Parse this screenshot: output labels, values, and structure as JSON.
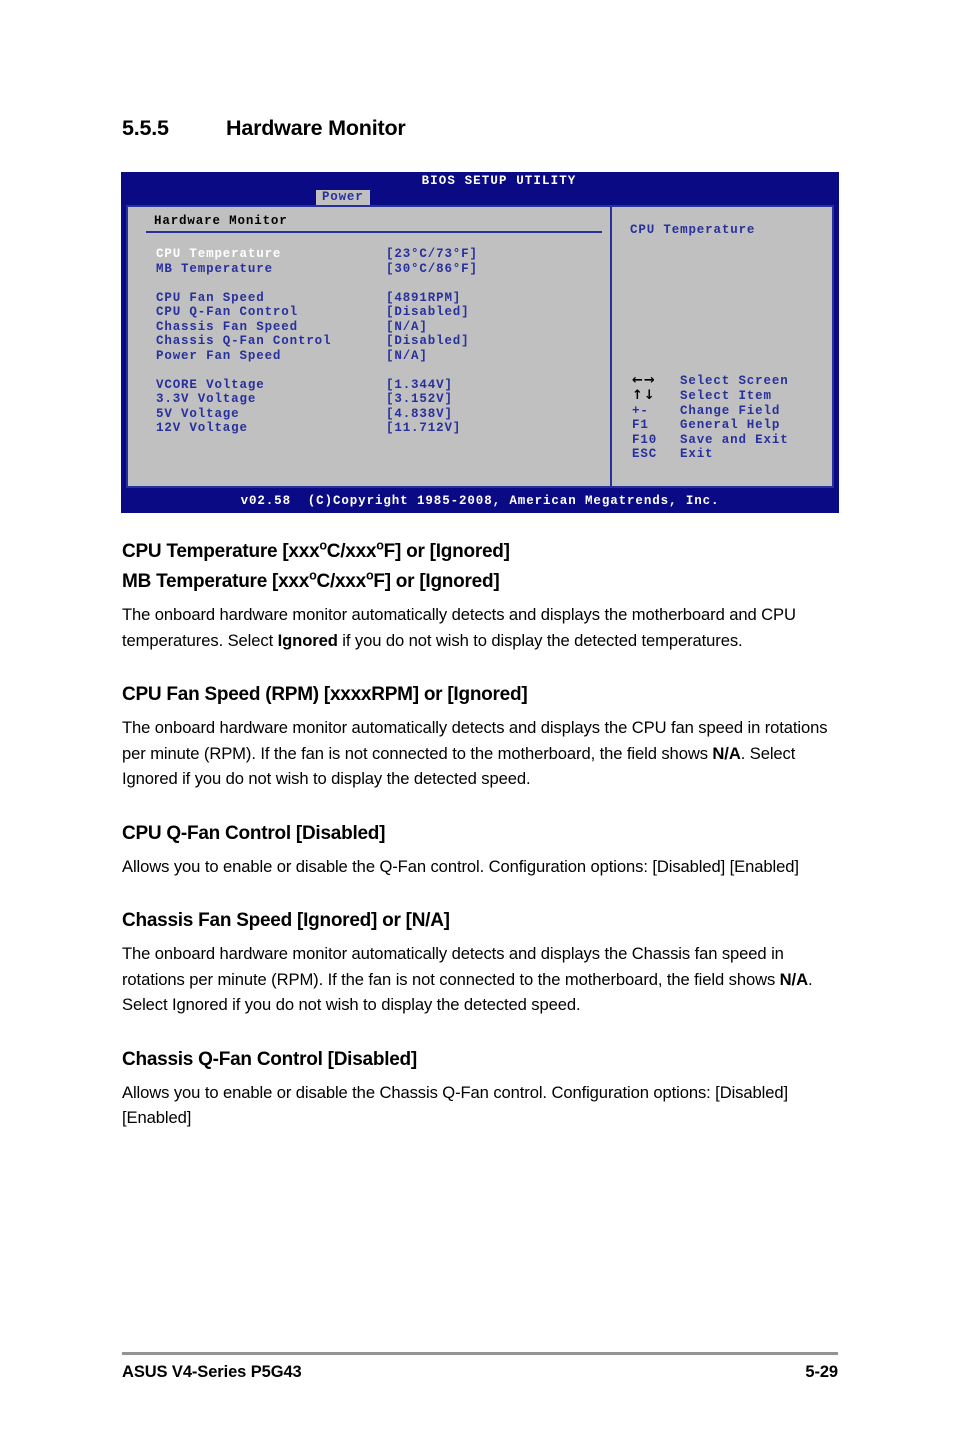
{
  "section": {
    "number": "5.5.5",
    "title": "Hardware Monitor"
  },
  "bios": {
    "title": "BIOS SETUP UTILITY",
    "tab": "Power",
    "panel_heading": "Hardware Monitor",
    "rows": [
      {
        "label": "CPU Temperature",
        "value": "[23°C/73°F]",
        "selected": true
      },
      {
        "label": "MB Temperature",
        "value": "[30°C/86°F]",
        "selected": false
      },
      {
        "label": "",
        "value": "",
        "gap": true
      },
      {
        "label": "CPU Fan Speed",
        "value": "[4891RPM]",
        "selected": false
      },
      {
        "label": "CPU Q-Fan Control",
        "value": "[Disabled]",
        "selected": false
      },
      {
        "label": "Chassis Fan Speed",
        "value": "[N/A]",
        "selected": false
      },
      {
        "label": "Chassis Q-Fan Control",
        "value": "[Disabled]",
        "selected": false
      },
      {
        "label": "Power Fan Speed",
        "value": "[N/A]",
        "selected": false
      },
      {
        "label": "",
        "value": "",
        "gap": true
      },
      {
        "label": "VCORE Voltage",
        "value": "[1.344V]",
        "selected": false
      },
      {
        "label": "3.3V Voltage",
        "value": "[3.152V]",
        "selected": false
      },
      {
        "label": "5V Voltage",
        "value": "[4.838V]",
        "selected": false
      },
      {
        "label": "12V Voltage",
        "value": "[11.712V]",
        "selected": false
      }
    ],
    "help_title": "CPU Temperature",
    "nav_keys": [
      {
        "key": "←→",
        "action": "Select Screen",
        "glyph": true
      },
      {
        "key": "↑↓",
        "action": "Select Item",
        "glyph": true
      },
      {
        "key": "+-",
        "action": "Change Field",
        "glyph": false
      },
      {
        "key": "F1",
        "action": "General Help",
        "glyph": false
      },
      {
        "key": "F10",
        "action": "Save and Exit",
        "glyph": false
      },
      {
        "key": "ESC",
        "action": "Exit",
        "glyph": false
      }
    ],
    "copyright": "v02.58  (C)Copyright 1985-2008, American Megatrends, Inc.",
    "colors": {
      "chrome_blue": "#0a0a84",
      "panel_gray": "#c0c0c0",
      "text_blue": "#28309c",
      "selected_white": "#ffffff"
    }
  },
  "content": {
    "cpu_temp_heading_a": "CPU Temperature [xxx",
    "cpu_temp_heading_b": "C/xxx",
    "cpu_temp_heading_c": "F] or [Ignored]",
    "mb_temp_heading_a": "MB Temperature [xxx",
    "mb_temp_heading_b": "C/xxx",
    "mb_temp_heading_c": "F] or [Ignored]",
    "deg": "o",
    "temp_para_1": "The onboard hardware monitor automatically detects and displays the motherboard and CPU temperatures. Select ",
    "temp_para_bold": "Ignored",
    "temp_para_2": " if you do not wish to display the detected temperatures.",
    "cpu_fan_heading": "CPU Fan Speed (RPM) [xxxxRPM] or [Ignored]",
    "cpu_fan_para_1": "The onboard hardware monitor automatically detects and displays the CPU fan speed in rotations per minute (RPM). If the fan is not connected to the motherboard, the field shows ",
    "cpu_fan_para_bold": "N/A",
    "cpu_fan_para_2": ". Select Ignored if you do not wish to display the detected speed.",
    "cpu_qfan_heading": "CPU Q-Fan Control [Disabled]",
    "cpu_qfan_para": "Allows you to enable or disable the Q-Fan control. Configuration options: [Disabled] [Enabled]",
    "chassis_fan_heading": "Chassis Fan Speed [Ignored] or [N/A]",
    "chassis_fan_para_1": "The onboard hardware monitor automatically detects and displays the Chassis fan speed in rotations per minute (RPM). If the fan is not connected to the motherboard, the field shows ",
    "chassis_fan_para_bold": "N/A",
    "chassis_fan_para_2": ". Select Ignored if you do not wish to display the detected speed.",
    "chassis_qfan_heading": "Chassis Q-Fan Control [Disabled]",
    "chassis_qfan_para": "Allows you to enable or disable the Chassis Q-Fan control. Configuration options: [Disabled] [Enabled]"
  },
  "footer": {
    "left": "ASUS V4-Series P5G43",
    "right": "5-29"
  }
}
